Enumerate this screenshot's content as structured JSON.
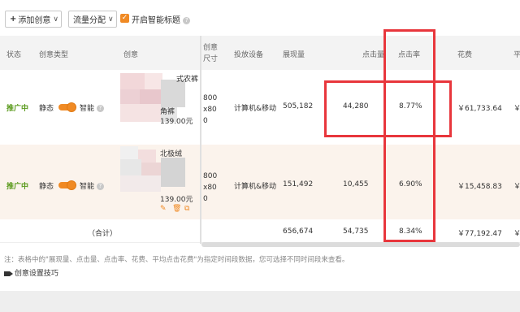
{
  "toolbar": {
    "add_creative": "添加创意",
    "traffic_split": "流量分配",
    "smart_title_label": "开启智能标题"
  },
  "table": {
    "headers": {
      "status": "状态",
      "creative_type": "创意类型",
      "creative": "创意",
      "size": "创意尺寸",
      "device": "投放设备",
      "impressions": "展现量",
      "clicks": "点击量",
      "ctr": "点击率",
      "cost": "花费",
      "avg_cpc_partial": "平"
    },
    "rows": [
      {
        "status": "推广中",
        "type": "静态",
        "smart": "智能",
        "title_top": "式农裤",
        "title_bottom": "角裤",
        "price": "139.00元",
        "size": "800x800",
        "device": "计算机&移动",
        "impressions": "505,182",
        "clicks": "44,280",
        "ctr": "8.77%",
        "cost": "￥61,733.64",
        "avg_cpc_partial": "￥"
      },
      {
        "status": "推广中",
        "type": "静态",
        "smart": "智能",
        "title_top": "北极绒",
        "price": "139.00元",
        "size": "800x800",
        "device": "计算机&移动",
        "impressions": "151,492",
        "clicks": "10,455",
        "ctr": "6.90%",
        "cost": "￥15,458.83",
        "avg_cpc_partial": "￥"
      }
    ],
    "total": {
      "label": "（合计）",
      "impressions": "656,674",
      "clicks": "54,735",
      "ctr": "8.34%",
      "cost": "￥77,192.47",
      "avg_cpc_partial": "￥"
    }
  },
  "note": "注：表格中的\"展现量、点击量、点击率、花费、平均点击花费\"为指定时间段数据，您可选择不同时间段来查看。",
  "tips_link": "创意设置技巧",
  "colors": {
    "accent": "#f08a24",
    "status_green": "#5a9a1c",
    "highlight_red": "#e8363c"
  }
}
